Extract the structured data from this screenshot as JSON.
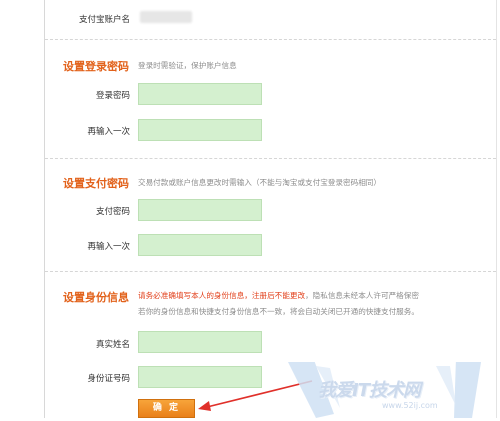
{
  "account": {
    "label": "支付宝账户名"
  },
  "login_section": {
    "title": "设置登录密码",
    "hint": "登录时需验证，保护账户信息",
    "password_label": "登录密码",
    "confirm_label": "再输入一次"
  },
  "pay_section": {
    "title": "设置支付密码",
    "hint": "交易付款或账户信息更改时需输入（不能与淘宝或支付宝登录密码相同）",
    "password_label": "支付密码",
    "confirm_label": "再输入一次"
  },
  "identity_section": {
    "title": "设置身份信息",
    "hint_red_1": "请务必准确填写本人的身份信息，",
    "hint_red_2": "注册后不能更改",
    "hint_gray_1": "，隐私信息未经本人许可严格保密",
    "hint_gray_2": "若你的身份信息和快捷支付身份信息不一致，将会自动关闭已开通的快捷支付服务。",
    "name_label": "真实姓名",
    "id_label": "身份证号码"
  },
  "submit": {
    "label": "确 定"
  },
  "watermark": {
    "text": "我爱IT技术网",
    "url": "www.52ij.com"
  },
  "colors": {
    "accent": "#e2621b",
    "field_bg": "#d4f0cf",
    "button": "#f19020",
    "annotation_arrow": "#e0302a"
  }
}
